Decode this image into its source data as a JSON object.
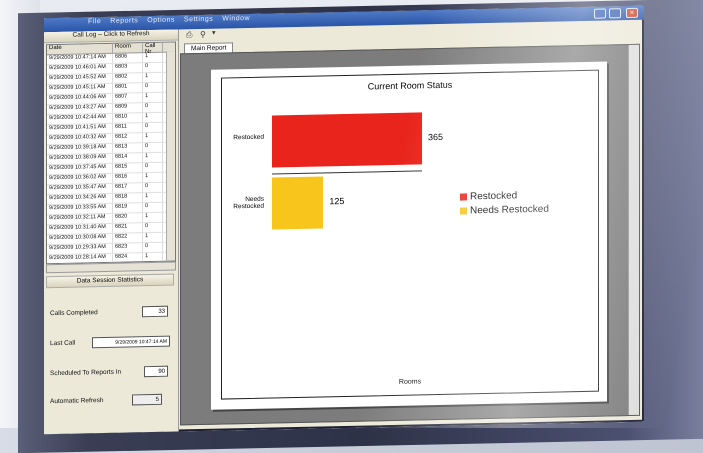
{
  "window": {
    "menu": [
      "File",
      "Reports",
      "Options",
      "Settings",
      "Window"
    ]
  },
  "left_panel": {
    "header": "Call Log – Click to Refresh",
    "columns": [
      "Date",
      "Room",
      "Call Nr"
    ],
    "rows": [
      [
        "9/29/2009 10:47:14 AM",
        "6806",
        "1"
      ],
      [
        "9/29/2009 10:46:01 AM",
        "6803",
        "0"
      ],
      [
        "9/29/2009 10:45:52 AM",
        "6802",
        "1"
      ],
      [
        "9/29/2009 10:45:11 AM",
        "6801",
        "0"
      ],
      [
        "9/29/2009 10:44:06 AM",
        "6807",
        "1"
      ],
      [
        "9/29/2009 10:43:27 AM",
        "6809",
        "0"
      ],
      [
        "9/29/2009 10:42:44 AM",
        "6810",
        "1"
      ],
      [
        "9/29/2009 10:41:51 AM",
        "6811",
        "0"
      ],
      [
        "9/29/2009 10:40:32 AM",
        "6812",
        "1"
      ],
      [
        "9/29/2009 10:39:18 AM",
        "6813",
        "0"
      ],
      [
        "9/29/2009 10:38:09 AM",
        "6814",
        "1"
      ],
      [
        "9/29/2009 10:37:45 AM",
        "6815",
        "0"
      ],
      [
        "9/29/2009 10:36:02 AM",
        "6816",
        "1"
      ],
      [
        "9/29/2009 10:35:47 AM",
        "6817",
        "0"
      ],
      [
        "9/29/2009 10:34:26 AM",
        "6818",
        "1"
      ],
      [
        "9/29/2009 10:33:55 AM",
        "6819",
        "0"
      ],
      [
        "9/29/2009 10:32:11 AM",
        "6820",
        "1"
      ],
      [
        "9/29/2009 10:31:40 AM",
        "6821",
        "0"
      ],
      [
        "9/29/2009 10:30:08 AM",
        "6822",
        "1"
      ],
      [
        "9/29/2009 10:29:33 AM",
        "6823",
        "0"
      ],
      [
        "9/29/2009 10:28:14 AM",
        "6824",
        "1"
      ],
      [
        "9/29/2009 10:27:51 AM",
        "6825",
        "0"
      ]
    ],
    "stats_title": "Data Session Statistics",
    "calls_completed_label": "Calls Completed",
    "calls_completed_value": "33",
    "last_call_label": "Last Call",
    "last_call_value": "9/29/2009 10:47:14 AM",
    "scheduled_reports_label": "Scheduled To Reports In",
    "scheduled_reports_value": "90",
    "automatic_refresh_label": "Automatic Refresh",
    "automatic_refresh_value": "5"
  },
  "report": {
    "tab_label": "Main Report",
    "toolbar_icons": [
      "printer-icon",
      "zoom-icon"
    ]
  },
  "chart_data": {
    "type": "bar",
    "orientation": "horizontal",
    "title": "Current Room Status",
    "categories": [
      "Restocked",
      "Needs Restocked"
    ],
    "values": [
      365,
      125
    ],
    "colors": [
      "#e8241c",
      "#f7c51c"
    ],
    "xlabel": "Rooms",
    "legend": [
      "Restocked",
      "Needs Restocked"
    ],
    "legend_position": "right",
    "xlim": [
      0,
      420
    ]
  }
}
